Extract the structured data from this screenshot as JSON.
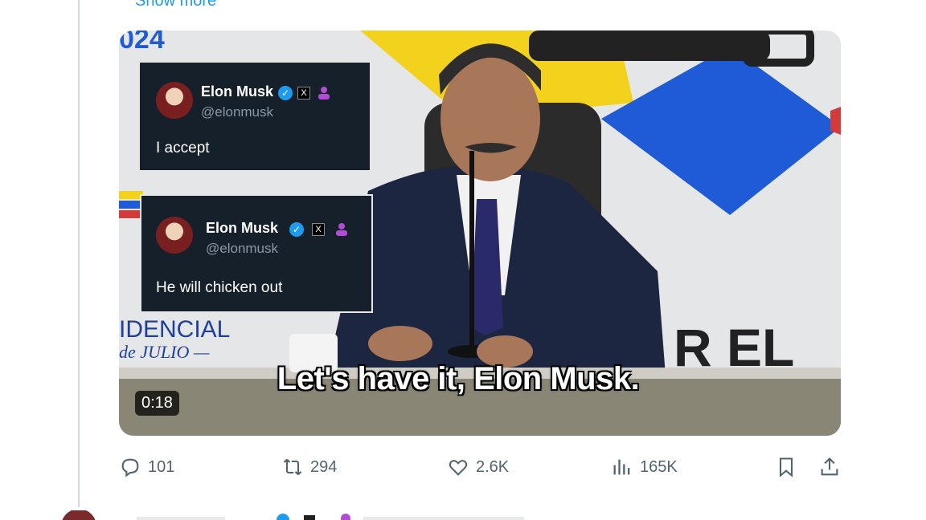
{
  "tweet": {
    "show_more": "Show more"
  },
  "video": {
    "duration": "0:18",
    "caption": "Let's have it, Elon Musk.",
    "background_text": {
      "year": "024",
      "sign_left_1": "IDENCIAL",
      "sign_left_2": "de JULIO —",
      "sign_right": "R EL"
    },
    "embedded_posts": [
      {
        "name": "Elon Musk",
        "handle": "@elonmusk",
        "text": "I accept",
        "x_glyph": "X"
      },
      {
        "name": "Elon Musk",
        "handle": "@elonmusk",
        "text": "He will chicken out",
        "x_glyph": "X"
      }
    ]
  },
  "actions": {
    "reply": {
      "icon": "reply-icon",
      "count": "101"
    },
    "repost": {
      "icon": "repost-icon",
      "count": "294"
    },
    "like": {
      "icon": "heart-icon",
      "count": "2.6K"
    },
    "views": {
      "icon": "views-icon",
      "count": "165K"
    },
    "bookmark": {
      "icon": "bookmark-icon"
    },
    "share": {
      "icon": "share-icon"
    }
  },
  "colors": {
    "accent": "#1d9bf0",
    "muted": "#536471",
    "card_bg": "#15202b"
  }
}
